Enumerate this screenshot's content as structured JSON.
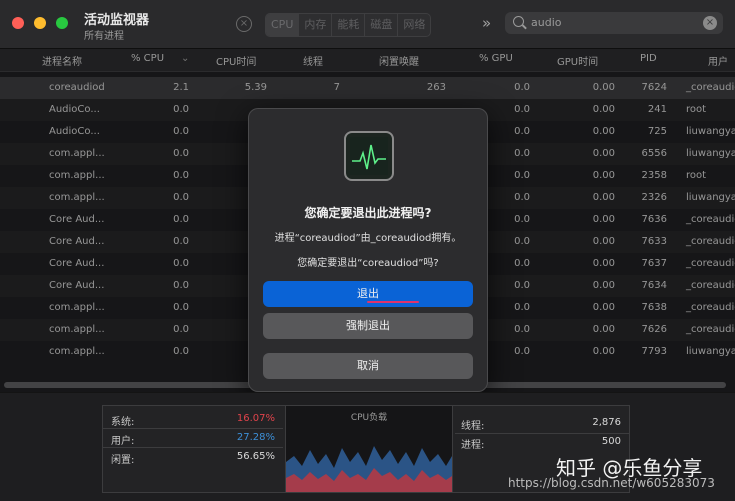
{
  "window": {
    "title": "活动监视器",
    "subtitle": "所有进程"
  },
  "toolbar": {
    "stop_icon": "×",
    "tabs": [
      "CPU",
      "内存",
      "能耗",
      "磁盘",
      "网络"
    ],
    "more_icon": "»",
    "search_value": "audio",
    "clear_icon": "×"
  },
  "table": {
    "columns": [
      "进程名称",
      "% CPU",
      "CPU时间",
      "线程",
      "闲置唤醒",
      "% GPU",
      "GPU时间",
      "PID",
      "用户"
    ],
    "sort_indicator": "⌄",
    "rows": [
      {
        "name": "coreaudiod",
        "cpu": "2.1",
        "cpu_time": "5.39",
        "threads": "7",
        "idle": "263",
        "gpu": "0.0",
        "gpu_time": "0.00",
        "pid": "7624",
        "user": "_coreaudiod"
      },
      {
        "name": "AudioCo...",
        "cpu": "0.0",
        "cpu_time": "",
        "threads": "",
        "idle": "",
        "gpu": "0.0",
        "gpu_time": "0.00",
        "pid": "241",
        "user": "root"
      },
      {
        "name": "AudioCo...",
        "cpu": "0.0",
        "cpu_time": "",
        "threads": "",
        "idle": "",
        "gpu": "0.0",
        "gpu_time": "0.00",
        "pid": "725",
        "user": "liuwangyang"
      },
      {
        "name": "com.appl...",
        "cpu": "0.0",
        "cpu_time": "",
        "threads": "",
        "idle": "",
        "gpu": "0.0",
        "gpu_time": "0.00",
        "pid": "6556",
        "user": "liuwangyang"
      },
      {
        "name": "com.appl...",
        "cpu": "0.0",
        "cpu_time": "",
        "threads": "",
        "idle": "",
        "gpu": "0.0",
        "gpu_time": "0.00",
        "pid": "2358",
        "user": "root"
      },
      {
        "name": "com.appl...",
        "cpu": "0.0",
        "cpu_time": "",
        "threads": "",
        "idle": "",
        "gpu": "0.0",
        "gpu_time": "0.00",
        "pid": "2326",
        "user": "liuwangyang"
      },
      {
        "name": "Core Aud...",
        "cpu": "0.0",
        "cpu_time": "",
        "threads": "",
        "idle": "",
        "gpu": "0.0",
        "gpu_time": "0.00",
        "pid": "7636",
        "user": "_coreaudiod"
      },
      {
        "name": "Core Aud...",
        "cpu": "0.0",
        "cpu_time": "",
        "threads": "",
        "idle": "",
        "gpu": "0.0",
        "gpu_time": "0.00",
        "pid": "7633",
        "user": "_coreaudiod"
      },
      {
        "name": "Core Aud...",
        "cpu": "0.0",
        "cpu_time": "",
        "threads": "",
        "idle": "",
        "gpu": "0.0",
        "gpu_time": "0.00",
        "pid": "7637",
        "user": "_coreaudiod"
      },
      {
        "name": "Core Aud...",
        "cpu": "0.0",
        "cpu_time": "",
        "threads": "",
        "idle": "",
        "gpu": "0.0",
        "gpu_time": "0.00",
        "pid": "7634",
        "user": "_coreaudiod"
      },
      {
        "name": "com.appl...",
        "cpu": "0.0",
        "cpu_time": "",
        "threads": "",
        "idle": "",
        "gpu": "0.0",
        "gpu_time": "0.00",
        "pid": "7638",
        "user": "_coreaudiod"
      },
      {
        "name": "com.appl...",
        "cpu": "0.0",
        "cpu_time": "",
        "threads": "",
        "idle": "",
        "gpu": "0.0",
        "gpu_time": "0.00",
        "pid": "7626",
        "user": "_coreaudiod"
      },
      {
        "name": "com.appl...",
        "cpu": "0.0",
        "cpu_time": "",
        "threads": "",
        "idle": "",
        "gpu": "0.0",
        "gpu_time": "0.00",
        "pid": "7793",
        "user": "liuwangyang"
      }
    ]
  },
  "dialog": {
    "icon": "activity-monitor-app-icon",
    "title": "您确定要退出此进程吗?",
    "message_line1": "进程“coreaudiod”由_coreaudiod拥有。",
    "message_line2": "您确定要退出“coreaudiod”吗?",
    "quit_label": "退出",
    "force_quit_label": "强制退出",
    "cancel_label": "取消"
  },
  "stats": {
    "system_label": "系统:",
    "system_value": "16.07%",
    "user_label": "用户:",
    "user_value": "27.28%",
    "idle_label": "闲置:",
    "idle_value": "56.65%",
    "cpu_load_label": "CPU负载",
    "threads_label": "线程:",
    "threads_value": "2,876",
    "processes_label": "进程:",
    "processes_value": "500",
    "system_color": "#e0434b",
    "user_color": "#3d8fd6"
  },
  "watermark": {
    "text": "知乎 @乐鱼分享",
    "url": "https://blog.csdn.net/w605283073"
  }
}
